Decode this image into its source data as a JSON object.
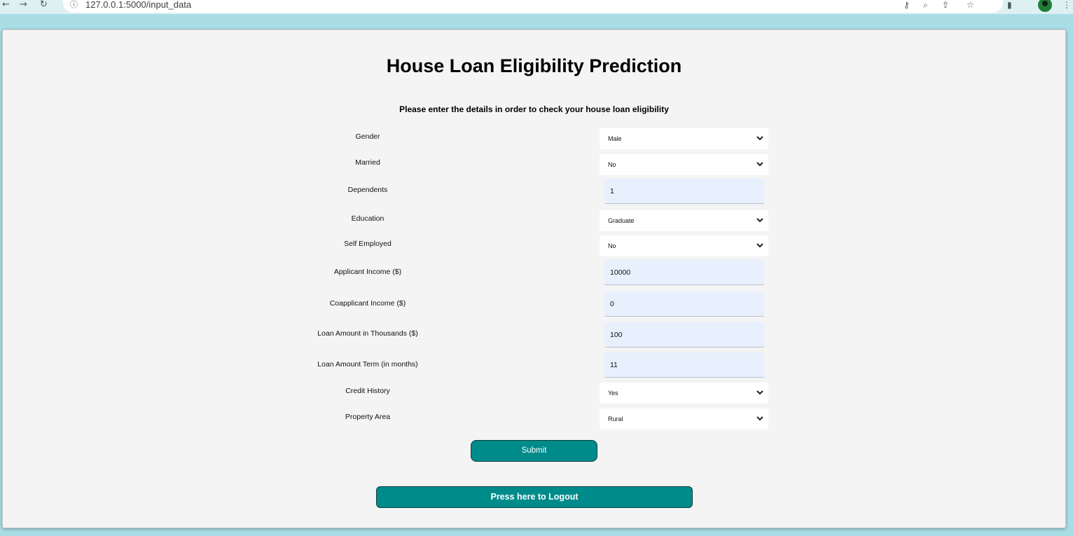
{
  "browser": {
    "url": "127.0.0.1:5000/input_data",
    "back_icon": "back-arrow-icon",
    "forward_icon": "forward-arrow-icon",
    "reload_icon": "reload-icon",
    "info_icon": "info-icon"
  },
  "page": {
    "title": "House Loan Eligibility Prediction",
    "subtitle": "Please enter the details in order to check your house loan eligibility"
  },
  "form": {
    "fields": [
      {
        "label": "Gender",
        "type": "select",
        "value": "Male"
      },
      {
        "label": "Married",
        "type": "select",
        "value": "No"
      },
      {
        "label": "Dependents",
        "type": "input",
        "value": "1"
      },
      {
        "label": "Education",
        "type": "select",
        "value": "Graduate"
      },
      {
        "label": "Self Employed",
        "type": "select",
        "value": "No"
      },
      {
        "label": "Applicant Income ($)",
        "type": "input",
        "value": "10000"
      },
      {
        "label": "Coapplicant Income ($)",
        "type": "input",
        "value": "0"
      },
      {
        "label": "Loan Amount in Thousands ($)",
        "type": "input",
        "value": "100"
      },
      {
        "label": "Loan Amount Term (in months)",
        "type": "input",
        "value": "11"
      },
      {
        "label": "Credit History",
        "type": "select",
        "value": "Yes"
      },
      {
        "label": "Property Area",
        "type": "select",
        "value": "Rural"
      }
    ],
    "submit_label": "Submit",
    "logout_label": "Press here to Logout"
  },
  "colors": {
    "accent": "#008b8b",
    "page_background": "#a9dde6",
    "card_background": "#f4f4f4",
    "input_fill": "#e8f0fe"
  }
}
